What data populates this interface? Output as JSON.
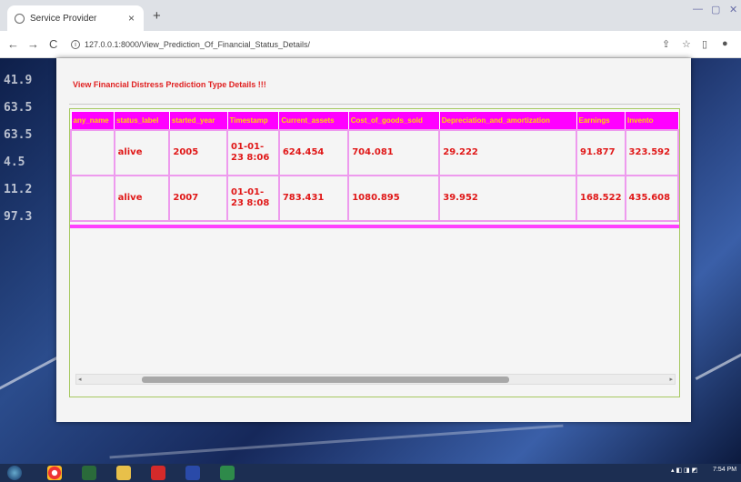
{
  "browser": {
    "tab_title": "Service Provider",
    "tab_close": "×",
    "new_tab": "+",
    "url": "127.0.0.1:8000/View_Prediction_Of_Financial_Status_Details/",
    "nav": {
      "back": "←",
      "forward": "→",
      "reload": "C"
    },
    "window_controls": [
      "—",
      "▢",
      "✕"
    ]
  },
  "page": {
    "title": "View Financial Distress Prediction Type Details !!!",
    "background_numbers": [
      "41.9",
      "63.5",
      "63.5",
      "4.5",
      "11.2",
      "97.3"
    ],
    "table": {
      "headers": [
        "any_name",
        "status_label",
        "started_year",
        "Timestamp",
        "Current_assets",
        "Cost_of_goods_sold",
        "Depreciation_and_amortization",
        "Earnings",
        "Invento"
      ],
      "rows": [
        [
          "",
          "alive",
          "2005",
          "01-01-23 8:06",
          "624.454",
          "704.081",
          "29.222",
          "91.877",
          "323.592"
        ],
        [
          "",
          "alive",
          "2007",
          "01-01-23 8:08",
          "783.431",
          "1080.895",
          "39.952",
          "168.522",
          "435.608"
        ]
      ]
    },
    "scrollbar": {
      "left": "◂",
      "right": "▸"
    }
  },
  "taskbar": {
    "time": "7:54 PM"
  },
  "colors": {
    "header_bg": "#ff00ff",
    "header_text": "#ffd600",
    "cell_text": "#e01818",
    "title": "#e02020",
    "frame_border": "#a6c860"
  }
}
